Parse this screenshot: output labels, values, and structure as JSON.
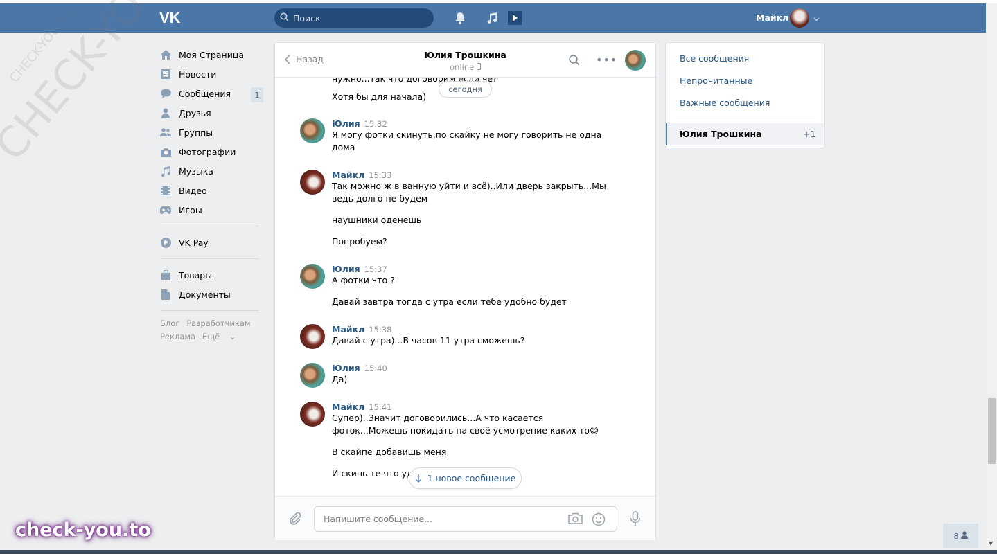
{
  "header": {
    "search_placeholder": "Поиск",
    "user_name": "Майкл"
  },
  "leftnav": {
    "items": [
      {
        "label": "Моя Страница",
        "icon": "home-icon"
      },
      {
        "label": "Новости",
        "icon": "news-icon"
      },
      {
        "label": "Сообщения",
        "icon": "messages-icon",
        "badge": "1"
      },
      {
        "label": "Друзья",
        "icon": "friends-icon"
      },
      {
        "label": "Группы",
        "icon": "groups-icon"
      },
      {
        "label": "Фотографии",
        "icon": "photos-icon"
      },
      {
        "label": "Музыка",
        "icon": "music-icon"
      },
      {
        "label": "Видео",
        "icon": "video-icon"
      },
      {
        "label": "Игры",
        "icon": "games-icon"
      }
    ],
    "vkpay": "VK Pay",
    "goods": "Товары",
    "documents": "Документы",
    "footer": {
      "blog": "Блог",
      "dev": "Разработчикам",
      "ads": "Реклама",
      "more": "Ещё"
    }
  },
  "chat": {
    "back_label": "Назад",
    "title": "Юлия Трошкина",
    "status": "online",
    "date_pill": "сегодня",
    "cut_line": "нужно...так что договорим если че?",
    "first_line": "Хотя бы для начала)",
    "messages": [
      {
        "author": "Юлия",
        "time": "15:32",
        "lines": [
          "Я могу фотки скинуть,по скайку не могу говорить не одна",
          "дома"
        ]
      },
      {
        "author": "Майкл",
        "time": "15:33",
        "lines": [
          "Так можно ж в ванную уйти и всё)..Или дверь закрыть...Мы",
          "ведь долго не будем"
        ],
        "extra": [
          "наушники оденешь",
          "Попробуем?"
        ]
      },
      {
        "author": "Юлия",
        "time": "15:37",
        "lines": [
          "А фотки что ?"
        ],
        "extra": [
          "Давай завтра тогда с утра если тебе удобно будет"
        ]
      },
      {
        "author": "Майкл",
        "time": "15:38",
        "lines": [
          "Давай с утра)...В часов 11 утра сможешь?"
        ]
      },
      {
        "author": "Юлия",
        "time": "15:40",
        "lines": [
          "Да)"
        ]
      },
      {
        "author": "Майкл",
        "time": "15:41",
        "lines": [
          "Супер)..Значит договорились...А что касается",
          "фоток...Можешь покидать на своё усмотрение каких то😊"
        ],
        "extra": [
          "В скайпе добавишь меня",
          "И скинь те что уда"
        ]
      }
    ],
    "new_message_pill": "1 новое сообщение",
    "composer_placeholder": "Напишите сообщение..."
  },
  "rpanel": {
    "all": "Все сообщения",
    "unread": "Непрочитанные",
    "important": "Важные сообщения",
    "active_name": "Юлия Трошкина",
    "active_count": "+1"
  },
  "watermark": {
    "big": "CHECK-YOU.ME",
    "small": "CHECK-YOU.ME",
    "brand": "check-you.to"
  },
  "friends_count": "8",
  "colors": {
    "header": "#4a76a8",
    "link": "#2a5885",
    "bg": "#edeef0"
  }
}
